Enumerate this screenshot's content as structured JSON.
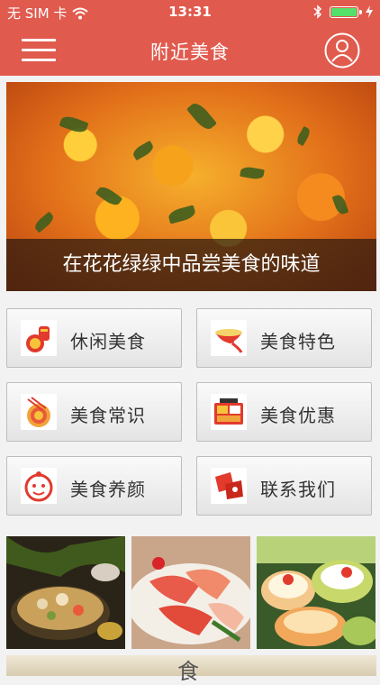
{
  "status_bar": {
    "carrier": "无 SIM 卡",
    "time": "13:31",
    "battery_level": 1.0
  },
  "nav": {
    "title": "附近美食",
    "menu_icon": "hamburger-menu-icon",
    "user_icon": "user-profile-icon"
  },
  "banner": {
    "caption": "在花花绿绿中品尝美食的味道"
  },
  "menu": {
    "items": [
      {
        "label": "休闲美食",
        "icon": "casual-food-icon"
      },
      {
        "label": "美食特色",
        "icon": "special-food-icon"
      },
      {
        "label": "美食常识",
        "icon": "food-knowledge-icon"
      },
      {
        "label": "美食优惠",
        "icon": "food-discount-icon"
      },
      {
        "label": "美食养颜",
        "icon": "food-beauty-icon"
      },
      {
        "label": "联系我们",
        "icon": "contact-icon"
      }
    ]
  },
  "gallery": {
    "items": [
      "hotpot-photo",
      "sashimi-photo",
      "melon-dessert-photo"
    ]
  },
  "bottom_banner": {
    "glyph": "食"
  },
  "colors": {
    "brand_red": "#e15a4e",
    "battery_green": "#55e06a"
  }
}
